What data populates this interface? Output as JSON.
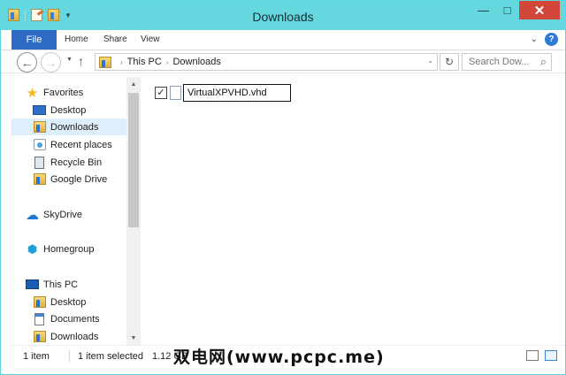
{
  "window": {
    "title": "Downloads",
    "controls": {
      "minimize": "—",
      "maximize": "□",
      "close": "✕"
    }
  },
  "ribbon": {
    "tabs": [
      "File",
      "Home",
      "Share",
      "View"
    ],
    "expand_label": "⌄",
    "help_label": "?"
  },
  "navigation": {
    "back_label": "←",
    "forward_label": "→",
    "recent_label": "▼",
    "up_label": "↑",
    "address_path": [
      "This PC",
      "Downloads"
    ],
    "address_drop": "⌄",
    "refresh_label": "↻",
    "search_placeholder": "Search Dow...",
    "search_icon": "search-icon"
  },
  "sidebar": {
    "items": [
      {
        "label": "Favorites",
        "icon": "star-icon",
        "selected": false
      },
      {
        "label": "Desktop",
        "icon": "desktop-icon",
        "selected": false
      },
      {
        "label": "Downloads",
        "icon": "downloads-folder-icon",
        "selected": true
      },
      {
        "label": "Recent places",
        "icon": "recent-places-icon",
        "selected": false
      },
      {
        "label": "Recycle Bin",
        "icon": "recycle-bin-icon",
        "selected": false
      },
      {
        "label": "Google Drive",
        "icon": "google-drive-folder-icon",
        "selected": false
      },
      {
        "label": "SkyDrive",
        "icon": "cloud-icon",
        "selected": false
      },
      {
        "label": "Homegroup",
        "icon": "homegroup-icon",
        "selected": false
      },
      {
        "label": "This PC",
        "icon": "computer-icon",
        "selected": false
      },
      {
        "label": "Desktop",
        "icon": "desktop-folder-icon",
        "selected": false
      },
      {
        "label": "Documents",
        "icon": "documents-icon",
        "selected": false
      },
      {
        "label": "Downloads",
        "icon": "downloads-folder-icon",
        "selected": false
      }
    ]
  },
  "files": [
    {
      "name": "VirtualXPVHD.vhd",
      "checked": true,
      "icon": "file-icon"
    }
  ],
  "status": {
    "item_count": "1 item",
    "selected_count": "1 item selected",
    "size": "1.12 GB"
  },
  "watermark": "双电网(www.pcpc.me)",
  "colors": {
    "titlebar": "#64d8de",
    "desktop": "#42cfd6",
    "file_tab": "#2d6bc5",
    "selection": "#ddeefd",
    "close_button": "#d3463a"
  }
}
